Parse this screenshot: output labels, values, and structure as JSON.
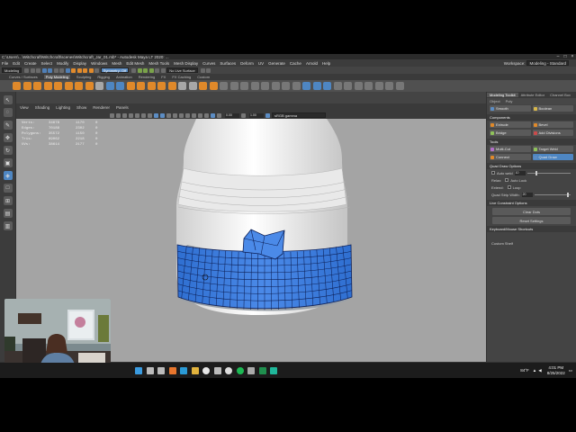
{
  "titlebar": {
    "title": "C:\\Users\\...\\Witchcraft\\Witchcraft\\scenes\\Witchcraft_Jar_01.mb* - Autodesk Maya LT 2020: ..."
  },
  "menubar": {
    "items": [
      "File",
      "Edit",
      "Create",
      "Select",
      "Modify",
      "Display",
      "Windows",
      "Mesh",
      "Edit Mesh",
      "Mesh Tools",
      "Mesh Display",
      "Curves",
      "Surfaces",
      "Deform",
      "UV",
      "Generate",
      "Cache",
      "Arnold",
      "Help"
    ],
    "workspace_label": "Workspace:",
    "workspace_value": "Modeling - Standard"
  },
  "statusline": {
    "mode": "Modeling",
    "symmetry": "Symmetry: Off",
    "no_live": "No Live Surface"
  },
  "shelf": {
    "tabs": [
      "Curves / Surfaces",
      "Poly Modeling",
      "Sculpting",
      "Rigging",
      "Animation",
      "Rendering",
      "FX",
      "FX Caching",
      "Custom"
    ],
    "active_tab": "Poly Modeling"
  },
  "viewport": {
    "menu": [
      "View",
      "Shading",
      "Lighting",
      "Show",
      "Renderer",
      "Panels"
    ],
    "exposure": "0.00",
    "gamma": "1.00",
    "color_space": "sRGB gamma",
    "hud": [
      {
        "label": "Verts:",
        "a": "34678",
        "b": "1170",
        "c": "0"
      },
      {
        "label": "Edges:",
        "a": "70188",
        "b": "2302",
        "c": "0"
      },
      {
        "label": "Polygons:",
        "a": "35572",
        "b": "1150",
        "c": "0"
      },
      {
        "label": "Tris:",
        "a": "69062",
        "b": "2218",
        "c": "0"
      },
      {
        "label": "UVs:",
        "a": "38614",
        "b": "2177",
        "c": "0"
      }
    ]
  },
  "right_panel": {
    "tabs": [
      "Modeling Toolkit",
      "Attribute Editor",
      "Channel Box"
    ],
    "active_tab": "Modeling Toolkit",
    "subtabs": [
      "Object",
      "Poly"
    ],
    "top_buttons": [
      [
        "Smooth",
        "Boolean"
      ]
    ],
    "components_header": "Components",
    "component_buttons": [
      [
        "Extrude",
        "Bevel"
      ],
      [
        "Bridge",
        "Add Divisions"
      ]
    ],
    "tools_header": "Tools",
    "tool_buttons": [
      [
        "Multi-Cut",
        "Target Weld"
      ],
      [
        "Connect",
        "Quad Draw"
      ]
    ],
    "active_tool": "Quad Draw",
    "options_header": "Quad Draw Options",
    "options": {
      "auto_weld": "Auto weld",
      "auto_weld_value": "10",
      "relax": "Relax:",
      "auto_lock": "Auto Lock",
      "extend": "Extend:",
      "loop": "Loop",
      "quad_strip_width": "Quad Strip Width:",
      "quad_strip_value": "20"
    },
    "live_constraint": "Live Constraint Options",
    "clear_button": "Clear Dots",
    "reset_button": "Reset Settings",
    "shortcuts": "Keyboard/Mouse Shortcuts",
    "custom_shelf": "Custom Shelf",
    "auto_weld_fraction": 0.2,
    "strip_fraction": 0.9
  },
  "cmdline": {
    "label": "MEL"
  },
  "taskbar": {
    "icons": [
      "windows-start-icon",
      "search-icon",
      "task-view-icon",
      "firefox-icon",
      "edge-icon",
      "file-explorer-icon",
      "chrome-icon",
      "settings-icon",
      "obs-icon",
      "spotify-icon",
      "gear-icon",
      "excel-icon",
      "maya-icon"
    ],
    "time": "4:01 PM",
    "date": "8/25/2022",
    "weather": "84°F"
  },
  "colors": {
    "accent": "#4e86c2",
    "wire": "#2f6fd1",
    "ui_bg": "#444444",
    "viewport_bg": "#a4a4a4"
  }
}
